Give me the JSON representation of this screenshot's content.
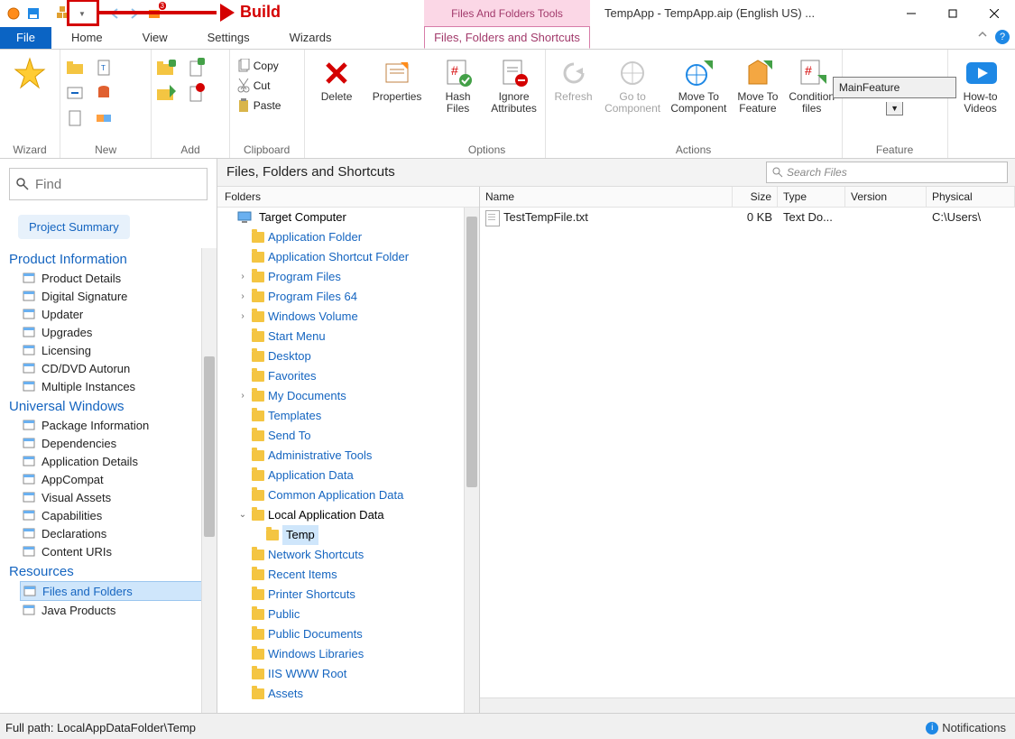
{
  "annotation": {
    "build_label": "Build"
  },
  "titlebar": {
    "tool_context": "Files And Folders Tools",
    "app_title": "TempApp - TempApp.aip (English US) ..."
  },
  "ribbon_tabs": {
    "file": "File",
    "home": "Home",
    "view": "View",
    "settings": "Settings",
    "wizards": "Wizards",
    "context": "Files, Folders and Shortcuts"
  },
  "ribbon": {
    "groups": {
      "wizard": {
        "label": "Wizard"
      },
      "new": {
        "label": "New"
      },
      "add": {
        "label": "Add"
      },
      "clipboard": {
        "label": "Clipboard",
        "copy": "Copy",
        "cut": "Cut",
        "paste": "Paste"
      },
      "delete": {
        "label": "Delete"
      },
      "properties": {
        "label": "Properties"
      },
      "options": {
        "label": "Options",
        "hash_files": "Hash Files",
        "ignore_attributes": "Ignore Attributes"
      },
      "actions": {
        "label": "Actions",
        "refresh": "Refresh",
        "go_to_component": "Go to Component",
        "move_to_component": "Move To Component",
        "move_to_feature": "Move To Feature",
        "condition_files": "Condition files"
      },
      "feature": {
        "label": "Feature",
        "selected": "MainFeature"
      },
      "howto_videos": "How-to Videos"
    }
  },
  "nav": {
    "find_placeholder": "Find",
    "project_summary": "Project Summary",
    "sections": {
      "product_information": {
        "title": "Product Information",
        "items": [
          "Product Details",
          "Digital Signature",
          "Updater",
          "Upgrades",
          "Licensing",
          "CD/DVD Autorun",
          "Multiple Instances"
        ]
      },
      "universal_windows": {
        "title": "Universal Windows",
        "items": [
          "Package Information",
          "Dependencies",
          "Application Details",
          "AppCompat",
          "Visual Assets",
          "Capabilities",
          "Declarations",
          "Content URIs"
        ]
      },
      "resources": {
        "title": "Resources",
        "items": [
          "Files and Folders",
          "Java Products"
        ]
      }
    }
  },
  "center": {
    "title": "Files, Folders and Shortcuts",
    "search_placeholder": "Search Files",
    "folders_header": "Folders",
    "tree": {
      "root": "Target Computer",
      "children": [
        {
          "label": "Application Folder"
        },
        {
          "label": "Application Shortcut Folder"
        },
        {
          "label": "Program Files",
          "expander": ">"
        },
        {
          "label": "Program Files 64",
          "expander": ">"
        },
        {
          "label": "Windows Volume",
          "expander": ">"
        },
        {
          "label": "Start Menu"
        },
        {
          "label": "Desktop"
        },
        {
          "label": "Favorites"
        },
        {
          "label": "My Documents",
          "expander": ">"
        },
        {
          "label": "Templates"
        },
        {
          "label": "Send To"
        },
        {
          "label": "Administrative Tools"
        },
        {
          "label": "Application Data"
        },
        {
          "label": "Common Application Data"
        },
        {
          "label": "Local Application Data",
          "expander": "v",
          "black": true,
          "children": [
            {
              "label": "Temp",
              "black": true,
              "selected": true
            }
          ]
        },
        {
          "label": "Network Shortcuts"
        },
        {
          "label": "Recent Items"
        },
        {
          "label": "Printer Shortcuts"
        },
        {
          "label": "Public"
        },
        {
          "label": "Public Documents"
        },
        {
          "label": "Windows Libraries"
        },
        {
          "label": "IIS WWW Root"
        },
        {
          "label": "Assets"
        }
      ]
    },
    "file_columns": [
      "Name",
      "Size",
      "Type",
      "Version",
      "Physical"
    ],
    "files": [
      {
        "name": "TestTempFile.txt",
        "size": "0 KB",
        "type": "Text Do...",
        "version": "",
        "physical": "C:\\Users\\"
      }
    ]
  },
  "status": {
    "full_path_label": "Full path:",
    "full_path_value": "LocalAppDataFolder\\Temp",
    "notifications": "Notifications"
  }
}
